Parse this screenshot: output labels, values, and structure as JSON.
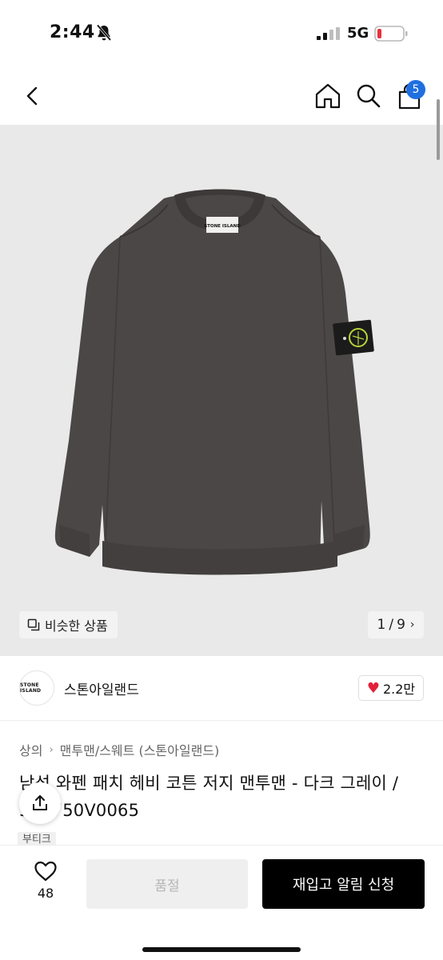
{
  "status_bar": {
    "time": "2:44",
    "network": "5G"
  },
  "nav": {
    "cart_count": "5"
  },
  "gallery": {
    "similar_label": "비슷한 상품",
    "page_current": "1",
    "page_separator": "/",
    "page_total": "9",
    "patch_text": "STONE ISLAND"
  },
  "brand": {
    "logo_text": "STONE ISLAND",
    "name": "스톤아일랜드",
    "likes": "2.2만"
  },
  "breadcrumb": {
    "level1": "상의",
    "level2": "맨투맨/스웨트 (스톤아일랜드)"
  },
  "product": {
    "title": "남성 와펜 패치 헤비 코튼 저지 맨투맨 - 다크 그레이 / 563750V0065",
    "tag": "부티크"
  },
  "bottom_bar": {
    "wish_count": "48",
    "soldout_label": "품절",
    "restock_label": "재입고 알림 신청"
  },
  "colors": {
    "accent_blue": "#1f6fe0",
    "heart_red": "#e3203a",
    "sweater_gray": "#4b4746",
    "badge_green": "#b8d43a"
  }
}
